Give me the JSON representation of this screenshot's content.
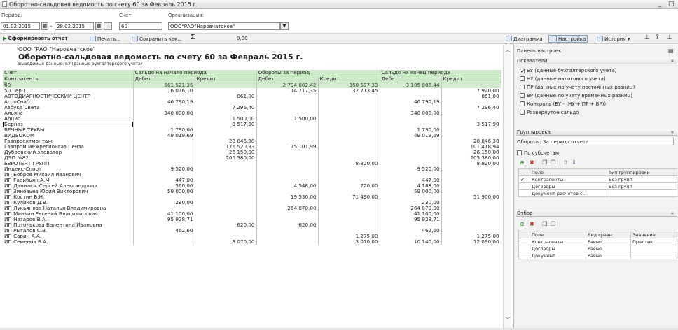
{
  "window": {
    "title": "Оборотно-сальдовая ведомость по счету 60 за Февраль 2015 г.",
    "minimize": "_",
    "close": "□"
  },
  "params": {
    "period_label": "Период:",
    "period_from": "01.02.2015",
    "period_sep": "–",
    "period_to": "28.02.2015",
    "account_label": "Счет:",
    "account_value": "60",
    "org_label": "Организация:",
    "org_value": "ООО\"РАО\"Наровчатское\"",
    "dots": "..."
  },
  "toolbar": {
    "generate": "Сформировать отчет",
    "print": "Печать...",
    "save": "Сохранить как...",
    "sum_symbol": "Σ",
    "sum_value": "0,00",
    "diagram": "Диаграмма",
    "settings": "Настройка",
    "history": "История"
  },
  "report": {
    "org": "ООО \"РАО \"Наровчатское\"",
    "title": "Оборотно-сальдовая ведомость по счету 60 за Февраль 2015 г.",
    "output": "Выводимые данные:  БУ (данные бухгалтерского учета)",
    "head1": [
      "Счет",
      "Сальдо на начало периода",
      "Обороты за период",
      "Сальдо на конец периода"
    ],
    "head2": [
      "Контрагенты",
      "Дебет",
      "Кредит",
      "Дебет",
      "Кредит",
      "Дебет",
      "Кредит"
    ],
    "group_marker": "⊟",
    "total": [
      "60",
      "661 521,35",
      "",
      "2 794 882,42",
      "350 597,33",
      "3 105 806,44",
      ""
    ],
    "rows": [
      [
        "50 Герц",
        "16 076,10",
        "",
        "14 717,35",
        "32 713,45",
        "",
        "7 920,00"
      ],
      [
        "АВТОДИАГНОСТИЧЕСКИЙ ЦЕНТР",
        "",
        "861,00",
        "",
        "",
        "",
        "861,00"
      ],
      [
        "АгроСнаб",
        "46 790,19",
        "",
        "",
        "",
        "46 790,19",
        ""
      ],
      [
        "Азбука Света",
        "",
        "7 296,40",
        "",
        "",
        "",
        "7 296,40"
      ],
      [
        "Альянс",
        "340 000,00",
        "",
        "",
        "",
        "340 000,00",
        ""
      ],
      [
        "Арцис",
        "",
        "1 500,00",
        "1 500,00",
        "",
        "",
        ""
      ],
      [
        "Берназ",
        "",
        "3 517,90",
        "",
        "",
        "",
        "3 517,90"
      ],
      [
        "ВЕЧНЫЕ ТРУБЫ",
        "1 730,00",
        "",
        "",
        "",
        "1 730,00",
        ""
      ],
      [
        "ВИДЕОКОМ",
        "49 019,69",
        "",
        "",
        "",
        "49 019,69",
        ""
      ],
      [
        "Газпроектмонтаж",
        "",
        "28 846,38",
        "",
        "",
        "",
        "28 846,38"
      ],
      [
        "Газпром межрегионгаз Пенза",
        "",
        "176 520,93",
        "75 101,99",
        "",
        "",
        "101 418,94"
      ],
      [
        "Дубровский элеватор",
        "",
        "26 150,00",
        "",
        "",
        "",
        "26 150,00"
      ],
      [
        "ДЭП №82",
        "",
        "205 380,00",
        "",
        "",
        "",
        "205 380,00"
      ],
      [
        "ЕВРОТЕНТ ГРУПП",
        "",
        "",
        "",
        "8 820,00",
        "",
        "8 820,00"
      ],
      [
        "Индекс-Спорт",
        "9 520,00",
        "",
        "",
        "",
        "9 520,00",
        ""
      ],
      [
        "ИП Бобров Михаил Иванович",
        "",
        "",
        "",
        "",
        "",
        ""
      ],
      [
        "ИП Гарибьян А.М.",
        "447,00",
        "",
        "",
        "",
        "447,00",
        ""
      ],
      [
        "ИП Данилюк Сергей Александрови",
        "360,00",
        "",
        "4 548,00",
        "720,00",
        "4 188,00",
        ""
      ],
      [
        "ИП Зиновьев Юрий Викторович",
        "59 000,00",
        "",
        "",
        "",
        "59 000,00",
        ""
      ],
      [
        "ИП Костин В.Н.",
        "",
        "",
        "19 530,00",
        "71 430,00",
        "",
        "51 900,00"
      ],
      [
        "ИП Куликов Д.В.",
        "230,00",
        "",
        "",
        "",
        "230,00",
        ""
      ],
      [
        "ИП Лукьянова Наталья Владимировна",
        "",
        "",
        "264 870,00",
        "",
        "264 870,00",
        ""
      ],
      [
        "ИП Минкин Евгений Владимирович",
        "41 100,00",
        "",
        "",
        "",
        "41 100,00",
        ""
      ],
      [
        "ИП Назаров В.А.",
        "95 928,71",
        "",
        "",
        "",
        "95 928,71",
        ""
      ],
      [
        "ИП Потолькова Валентина Ивановна",
        "",
        "620,00",
        "620,00",
        "",
        "",
        ""
      ],
      [
        "ИП Рыгалов С.В.",
        "462,60",
        "",
        "",
        "",
        "462,60",
        ""
      ],
      [
        "ИП Сарин А.А.",
        "",
        "",
        "",
        "1 275,00",
        "",
        "1 275,00"
      ],
      [
        "ИП Семенов В.А.",
        "",
        "3 070,00",
        "",
        "3 070,00",
        "10 140,00",
        "12 090,00"
      ]
    ]
  },
  "panel": {
    "header": "Панель настроек",
    "indicators_title": "Показатели",
    "indicators": [
      {
        "label": "БУ (данные бухгалтерского учета)",
        "checked": "✔"
      },
      {
        "label": "НУ (данные налогового учета)",
        "checked": ""
      },
      {
        "label": "ПР (данные по учету постоянных разниц)",
        "checked": ""
      },
      {
        "label": "ВР (данные по учету временных разниц)",
        "checked": ""
      },
      {
        "label": "Контроль (БУ - (НУ + ПР + ВР))",
        "checked": ""
      },
      {
        "label": "Развернутое сальдо",
        "checked": ""
      }
    ],
    "grouping_title": "Группировка",
    "turnover_label": "Обороты:",
    "turnover_value": "За период отчета",
    "by_subaccounts": "По субсчетам",
    "grouping_cols": [
      "Поле",
      "Тип группировки"
    ],
    "grouping_rows": [
      {
        "field": "Контрагенты",
        "type": "Без групп",
        "checked": "✔"
      },
      {
        "field": "Договоры",
        "type": "Без групп",
        "checked": ""
      },
      {
        "field": "Документ расчетов с...",
        "type": "",
        "checked": ""
      }
    ],
    "filter_title": "Отбор",
    "filter_cols": [
      "Поле",
      "Вид сравн...",
      "Значение"
    ],
    "filter_rows": [
      {
        "field": "Контрагенты",
        "cmp": "Равно",
        "value": "Пралтик"
      },
      {
        "field": "Договоры",
        "cmp": "Равно",
        "value": ""
      },
      {
        "field": "Документ...",
        "cmp": "Равно",
        "value": ""
      }
    ]
  }
}
